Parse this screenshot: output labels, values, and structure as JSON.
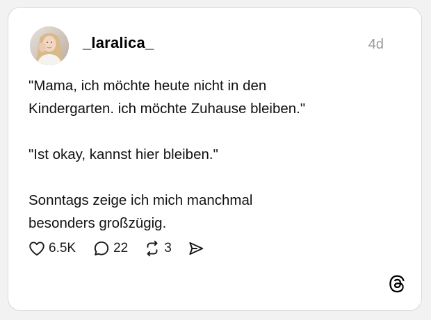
{
  "post": {
    "username": "_laralica_",
    "timestamp": "4d",
    "paragraphs": [
      "\"Mama, ich möchte heute nicht in den Kindergarten. ich möchte Zuhause bleiben.\"",
      "\"Ist okay, kannst hier bleiben.\"",
      "Sonntags zeige ich mich manchmal besonders großzügig."
    ],
    "paragraph_lines": [
      [
        "\"Mama, ich möchte heute nicht in den",
        "Kindergarten. ich möchte Zuhause bleiben.\""
      ],
      [
        "\"Ist okay, kannst hier bleiben.\""
      ],
      [
        "Sonntags zeige ich mich manchmal",
        "besonders großzügig."
      ]
    ]
  },
  "actions": {
    "likes": "6.5K",
    "replies": "22",
    "reposts": "3"
  },
  "icons": {
    "like": "heart-icon",
    "reply": "speech-bubble-icon",
    "repost": "repost-icon",
    "share": "send-icon",
    "logo": "threads-logo-icon"
  },
  "colors": {
    "background": "#f2f2f2",
    "card": "#ffffff",
    "timestamp": "#999999"
  }
}
